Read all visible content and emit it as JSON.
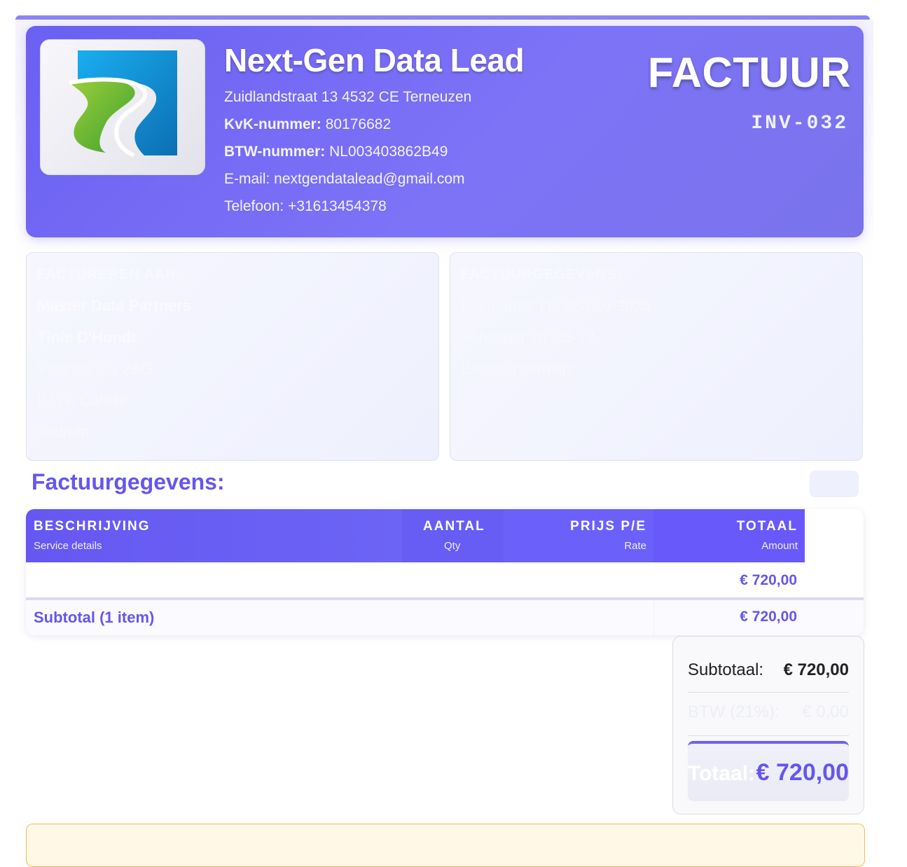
{
  "header": {
    "company_name": "Next-Gen Data Lead",
    "address": "Zuidlandstraat 13 4532 CE Terneuzen",
    "kvk_label": "KvK-nummer:",
    "kvk_value": "80176682",
    "btw_label": "BTW-nummer:",
    "btw_value": "NL003403862B49",
    "email": "E-mail: nextgendatalead@gmail.com",
    "phone": "Telefoon: +31613454378",
    "doc_title": "FACTUUR",
    "invoice_number": "INV-032"
  },
  "bill_to": {
    "title": "FACTUREREN AAN:",
    "company": "Master Data Partners",
    "contact": "Tinie D'Hondt",
    "line3": "Veldhov 2.0 2&G",
    "line4": "BTW: Catalis",
    "line5": "nadrum"
  },
  "invoice_details": {
    "title": "FACTUURGEGEVENS:",
    "line1": "Factuurdatum: 25-nov-2025",
    "line2": "Vervaldatum: 25-12-",
    "line3": "Betalingstermijn:"
  },
  "section_title": "Factuurgegevens:",
  "table": {
    "columns": [
      {
        "label": "BESCHRIJVING",
        "sub": "Service details"
      },
      {
        "label": "AANTAL",
        "sub": "Qty"
      },
      {
        "label": "PRIJS P/E",
        "sub": "Rate"
      },
      {
        "label": "TOTAAL",
        "sub": "Amount"
      }
    ],
    "rows": [
      {
        "description": "",
        "qty": "",
        "rate": "",
        "amount": "€ 720,00"
      }
    ],
    "subtotal_label": "Subtotal (1 item)",
    "subtotal_amount": "€ 720,00"
  },
  "totals": {
    "subtotal_label": "Subtotaal:",
    "subtotal_value": "€ 720,00",
    "vat_label": "BTW (21%):",
    "vat_value": "€ 0,00",
    "total_label": "Totaal:",
    "total_value": "€ 720,00"
  },
  "colors": {
    "accent": "#6556ee",
    "header_bg": "#7168f5",
    "note_border": "#f3bd55"
  }
}
